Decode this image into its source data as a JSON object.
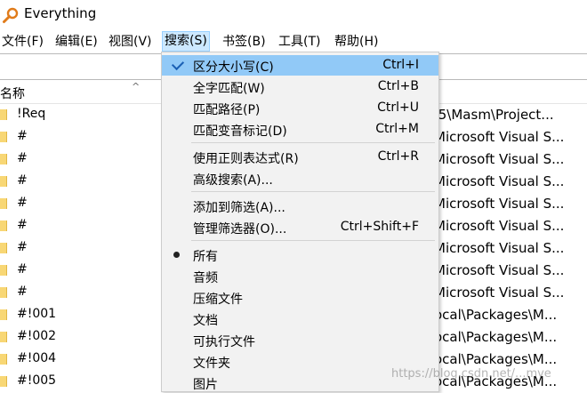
{
  "window": {
    "title": "Everything"
  },
  "menubar": [
    {
      "label": "文件(F)"
    },
    {
      "label": "编辑(E)"
    },
    {
      "label": "视图(V)"
    },
    {
      "label": "搜索(S)"
    },
    {
      "label": "书签(B)"
    },
    {
      "label": "工具(T)"
    },
    {
      "label": "帮助(H)"
    }
  ],
  "columns": {
    "name": "名称"
  },
  "rows": [
    {
      "name": "!Req",
      "path": ".5\\Masm\\Project..."
    },
    {
      "name": "#",
      "path": "Microsoft Visual S..."
    },
    {
      "name": "#",
      "path": "Microsoft Visual S..."
    },
    {
      "name": "#",
      "path": "Microsoft Visual S..."
    },
    {
      "name": "#",
      "path": "Microsoft Visual S..."
    },
    {
      "name": "#",
      "path": "Microsoft Visual S..."
    },
    {
      "name": "#",
      "path": "Microsoft Visual S..."
    },
    {
      "name": "#",
      "path": "Microsoft Visual S..."
    },
    {
      "name": "#",
      "path": "Microsoft Visual S..."
    },
    {
      "name": "#!001",
      "path": "ocal\\Packages\\M..."
    },
    {
      "name": "#!002",
      "path": "ocal\\Packages\\M..."
    },
    {
      "name": "#!004",
      "path": "ocal\\Packages\\M..."
    },
    {
      "name": "#!005",
      "path": "ocal\\Packages\\M..."
    }
  ],
  "search_menu": {
    "items": [
      {
        "label": "区分大小写(C)",
        "shortcut": "Ctrl+I"
      },
      {
        "label": "全字匹配(W)",
        "shortcut": "Ctrl+B"
      },
      {
        "label": "匹配路径(P)",
        "shortcut": "Ctrl+U"
      },
      {
        "label": "匹配变音标记(D)",
        "shortcut": "Ctrl+M"
      },
      {
        "label": "使用正则表达式(R)",
        "shortcut": "Ctrl+R"
      },
      {
        "label": "高级搜索(A)...",
        "shortcut": ""
      },
      {
        "label": "添加到筛选(A)...",
        "shortcut": ""
      },
      {
        "label": "管理筛选器(O)...",
        "shortcut": "Ctrl+Shift+F"
      },
      {
        "label": "所有",
        "shortcut": ""
      },
      {
        "label": "音频",
        "shortcut": ""
      },
      {
        "label": "压缩文件",
        "shortcut": ""
      },
      {
        "label": "文档",
        "shortcut": ""
      },
      {
        "label": "可执行文件",
        "shortcut": ""
      },
      {
        "label": "文件夹",
        "shortcut": ""
      },
      {
        "label": "图片",
        "shortcut": ""
      }
    ]
  },
  "watermark": "https://blog.csdn.net/...mve",
  "colors": {
    "highlight": "#91c9f7",
    "menu_active": "#cce8ff",
    "folder": "#f8d775"
  }
}
